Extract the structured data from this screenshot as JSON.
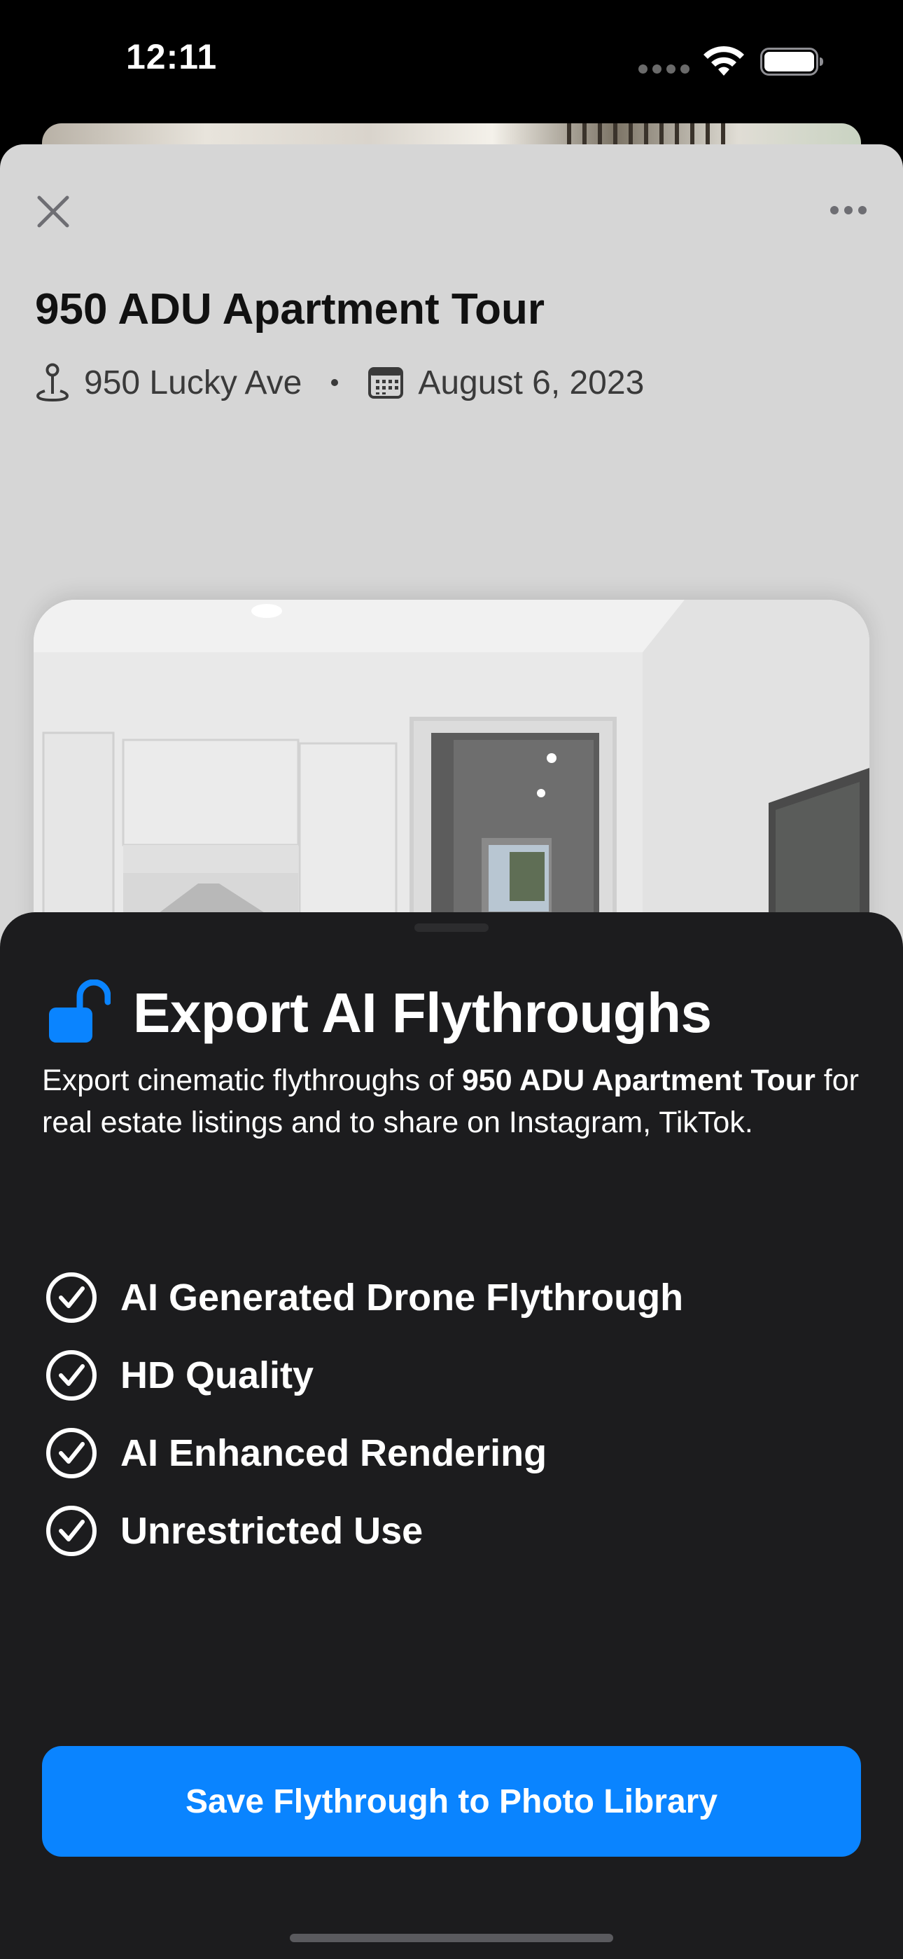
{
  "status_bar": {
    "time": "12:11",
    "icons": [
      "signal-dots-icon",
      "wifi-icon",
      "battery-icon"
    ]
  },
  "sheet": {
    "close_icon": "close-icon",
    "more_icon": "more-icon",
    "title": "950 ADU Apartment Tour",
    "location": "950 Lucky Ave",
    "date": "August 6, 2023",
    "location_icon": "map-pin-icon",
    "date_icon": "calendar-icon",
    "photo_icon": "room-photo"
  },
  "paywall": {
    "lock_icon": "unlocked-lock-icon",
    "title": "Export AI Flythroughs",
    "description_prefix": "Export cinematic flythroughs of ",
    "description_bold": "950 ADU Apartment Tour",
    "description_suffix": " for real estate listings and to share on Instagram, TikTok.",
    "features": [
      "AI Generated Drone Flythrough",
      "HD Quality",
      "AI Enhanced Rendering",
      "Unrestricted Use"
    ],
    "feature_icon": "checkmark-circle-icon",
    "button_label": "Save Flythrough to Photo Library"
  },
  "colors": {
    "accent": "#0a84ff",
    "sheet_background": "#d6d6d6",
    "paywall_background": "#1c1c1e"
  }
}
